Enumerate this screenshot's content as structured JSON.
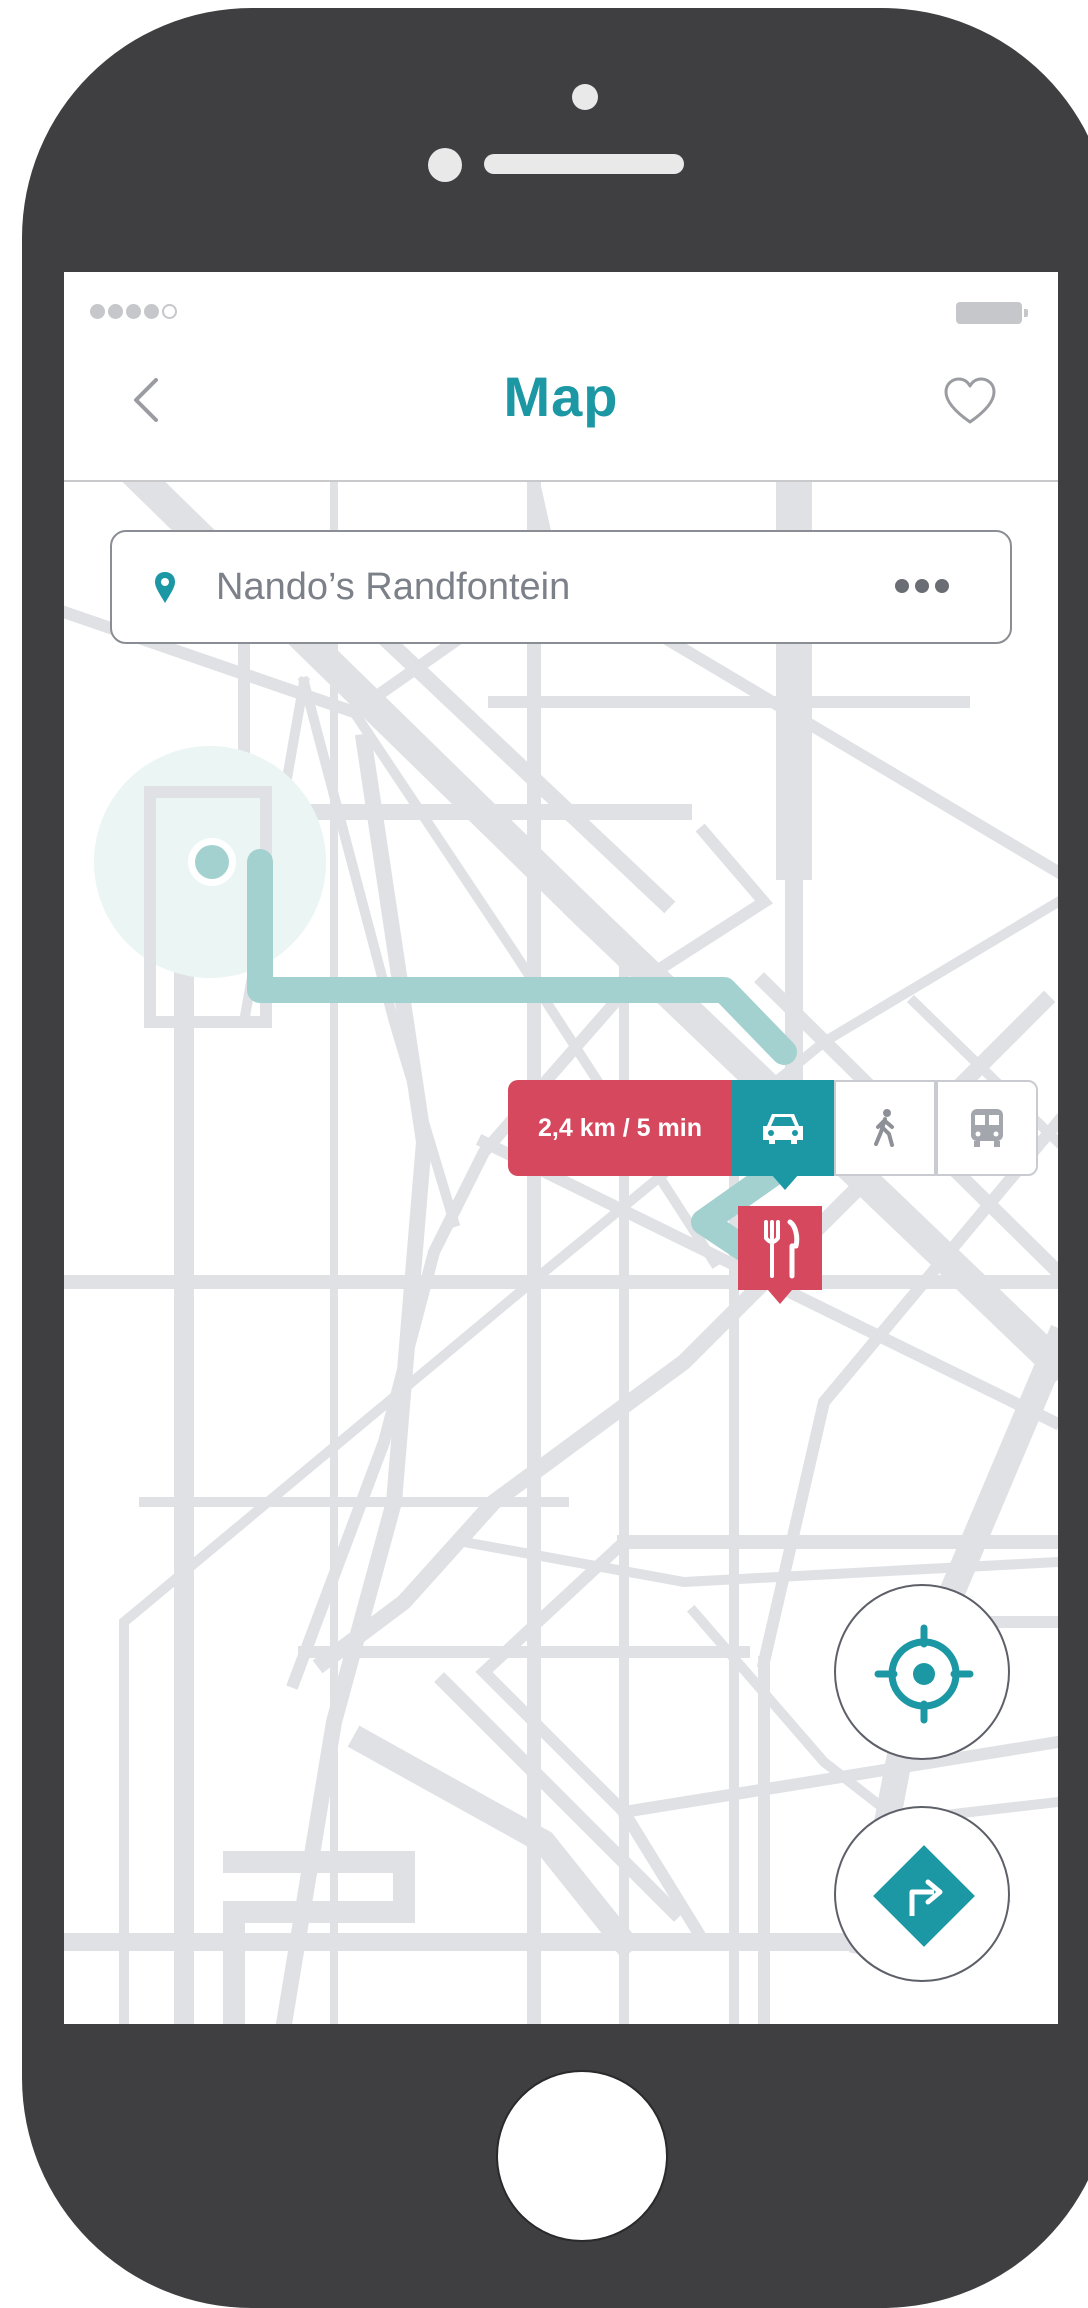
{
  "navbar": {
    "title": "Map",
    "back_icon": "chevron-left-icon",
    "favorite_icon": "heart-icon"
  },
  "statusbar": {
    "signal_bars_filled": 4,
    "signal_bars_total": 5,
    "battery_icon": "battery-icon"
  },
  "search": {
    "value": "Nando’s Randfontein",
    "pin_icon": "location-pin-icon",
    "more_icon": "more-dots-icon"
  },
  "route": {
    "distance_time": "2,4 km / 5 min",
    "modes": [
      {
        "name": "car",
        "icon": "car-icon",
        "active": true
      },
      {
        "name": "walk",
        "icon": "walk-icon",
        "active": false
      },
      {
        "name": "transit",
        "icon": "bus-icon",
        "active": false
      }
    ]
  },
  "destination": {
    "icon": "restaurant-icon"
  },
  "actions": {
    "locate_icon": "crosshair-icon",
    "directions_icon": "turn-right-icon"
  },
  "colors": {
    "accent": "#1c97a4",
    "destination": "#d6485d",
    "route_line": "#a3d1cf",
    "roads": "#dfe1e5"
  }
}
